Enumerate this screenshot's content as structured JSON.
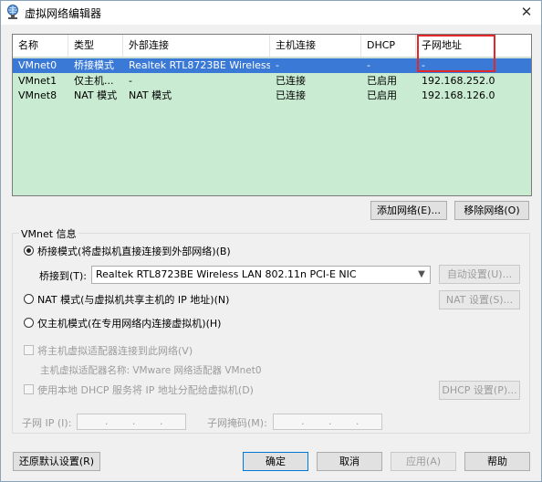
{
  "window": {
    "title": "虚拟网络编辑器",
    "close_glyph": "✕"
  },
  "table": {
    "columns": [
      "名称",
      "类型",
      "外部连接",
      "主机连接",
      "DHCP",
      "子网地址"
    ],
    "rows": [
      {
        "name": "VMnet0",
        "type": "桥接模式",
        "external": "Realtek RTL8723BE Wireless...",
        "host": "-",
        "dhcp": "-",
        "subnet": "-",
        "selected": true
      },
      {
        "name": "VMnet1",
        "type": "仅主机...",
        "external": "-",
        "host": "已连接",
        "dhcp": "已启用",
        "subnet": "192.168.252.0",
        "selected": false
      },
      {
        "name": "VMnet8",
        "type": "NAT 模式",
        "external": "NAT 模式",
        "host": "已连接",
        "dhcp": "已启用",
        "subnet": "192.168.126.0",
        "selected": false
      }
    ]
  },
  "buttons": {
    "add_network": "添加网络(E)...",
    "remove_network": "移除网络(O)",
    "auto_settings": "自动设置(U)...",
    "nat_settings": "NAT 设置(S)...",
    "dhcp_settings": "DHCP 设置(P)...",
    "restore_defaults": "还原默认设置(R)",
    "ok": "确定",
    "cancel": "取消",
    "apply": "应用(A)",
    "help": "帮助"
  },
  "vmnet_info": {
    "group_label": "VMnet 信息",
    "bridged_label": "桥接模式(将虚拟机直接连接到外部网络)(B)",
    "bridged_to_label": "桥接到(T):",
    "bridged_to_value": "Realtek RTL8723BE Wireless LAN 802.11n PCI-E NIC",
    "nat_label": "NAT 模式(与虚拟机共享主机的 IP 地址)(N)",
    "host_only_label": "仅主机模式(在专用网络内连接虚拟机)(H)",
    "connect_adapter_label": "将主机虚拟适配器连接到此网络(V)",
    "adapter_name_label": "主机虚拟适配器名称: VMware 网络适配器 VMnet0",
    "use_dhcp_label": "使用本地 DHCP 服务将 IP 地址分配给虚拟机(D)",
    "subnet_ip_label": "子网 IP (I):",
    "subnet_mask_label": "子网掩码(M):"
  },
  "colors": {
    "table_bg": "#c9ebd2",
    "selection": "#3b79d6",
    "highlight": "#e0282d"
  }
}
